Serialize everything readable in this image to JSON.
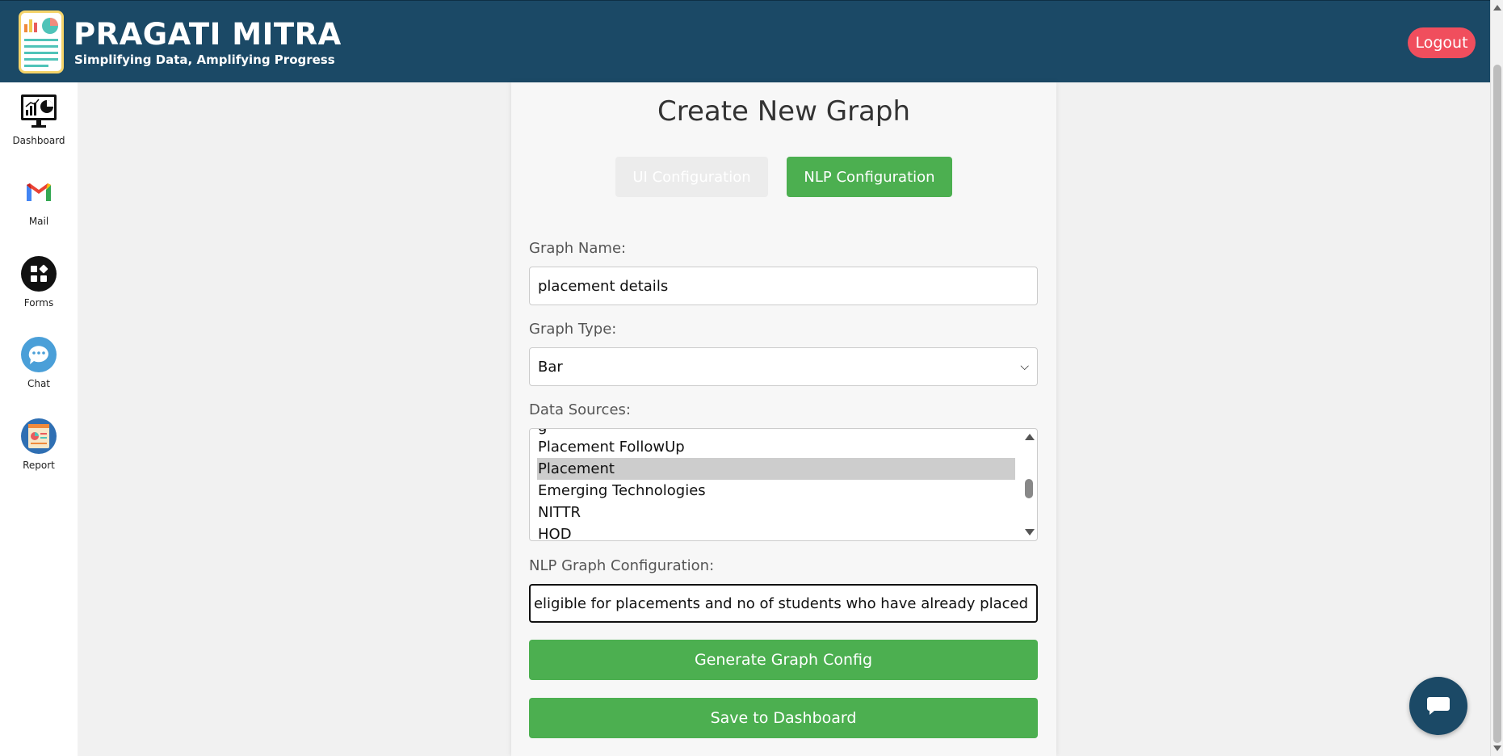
{
  "header": {
    "title": "PRAGATI MITRA",
    "subtitle": "Simplifying Data, Amplifying Progress",
    "logout_label": "Logout"
  },
  "sidebar": {
    "items": [
      {
        "label": "Dashboard",
        "icon": "dashboard-monitor-icon"
      },
      {
        "label": "Mail",
        "icon": "gmail-icon"
      },
      {
        "label": "Forms",
        "icon": "forms-icon"
      },
      {
        "label": "Chat",
        "icon": "chat-bubble-icon"
      },
      {
        "label": "Report",
        "icon": "report-icon"
      }
    ]
  },
  "main": {
    "title": "Create New Graph",
    "tabs": [
      {
        "label": "UI Configuration",
        "active": false
      },
      {
        "label": "NLP Configuration",
        "active": true
      }
    ],
    "graph_name": {
      "label": "Graph Name:",
      "value": "placement details"
    },
    "graph_type": {
      "label": "Graph Type:",
      "value": "Bar"
    },
    "data_sources": {
      "label": "Data Sources:",
      "options": [
        "Placement FollowUp",
        "Placement",
        "Emerging Technologies",
        "NITTR",
        "HOD"
      ],
      "selected": "Placement"
    },
    "nlp_config": {
      "label": "NLP Graph Configuration:",
      "value": "eligible for placements and no of students who have already placed"
    },
    "generate_label": "Generate Graph Config",
    "save_label": "Save to Dashboard"
  },
  "colors": {
    "header_bg": "#1b4966",
    "accent_green": "#4caf50",
    "logout_red": "#f04e5d"
  }
}
